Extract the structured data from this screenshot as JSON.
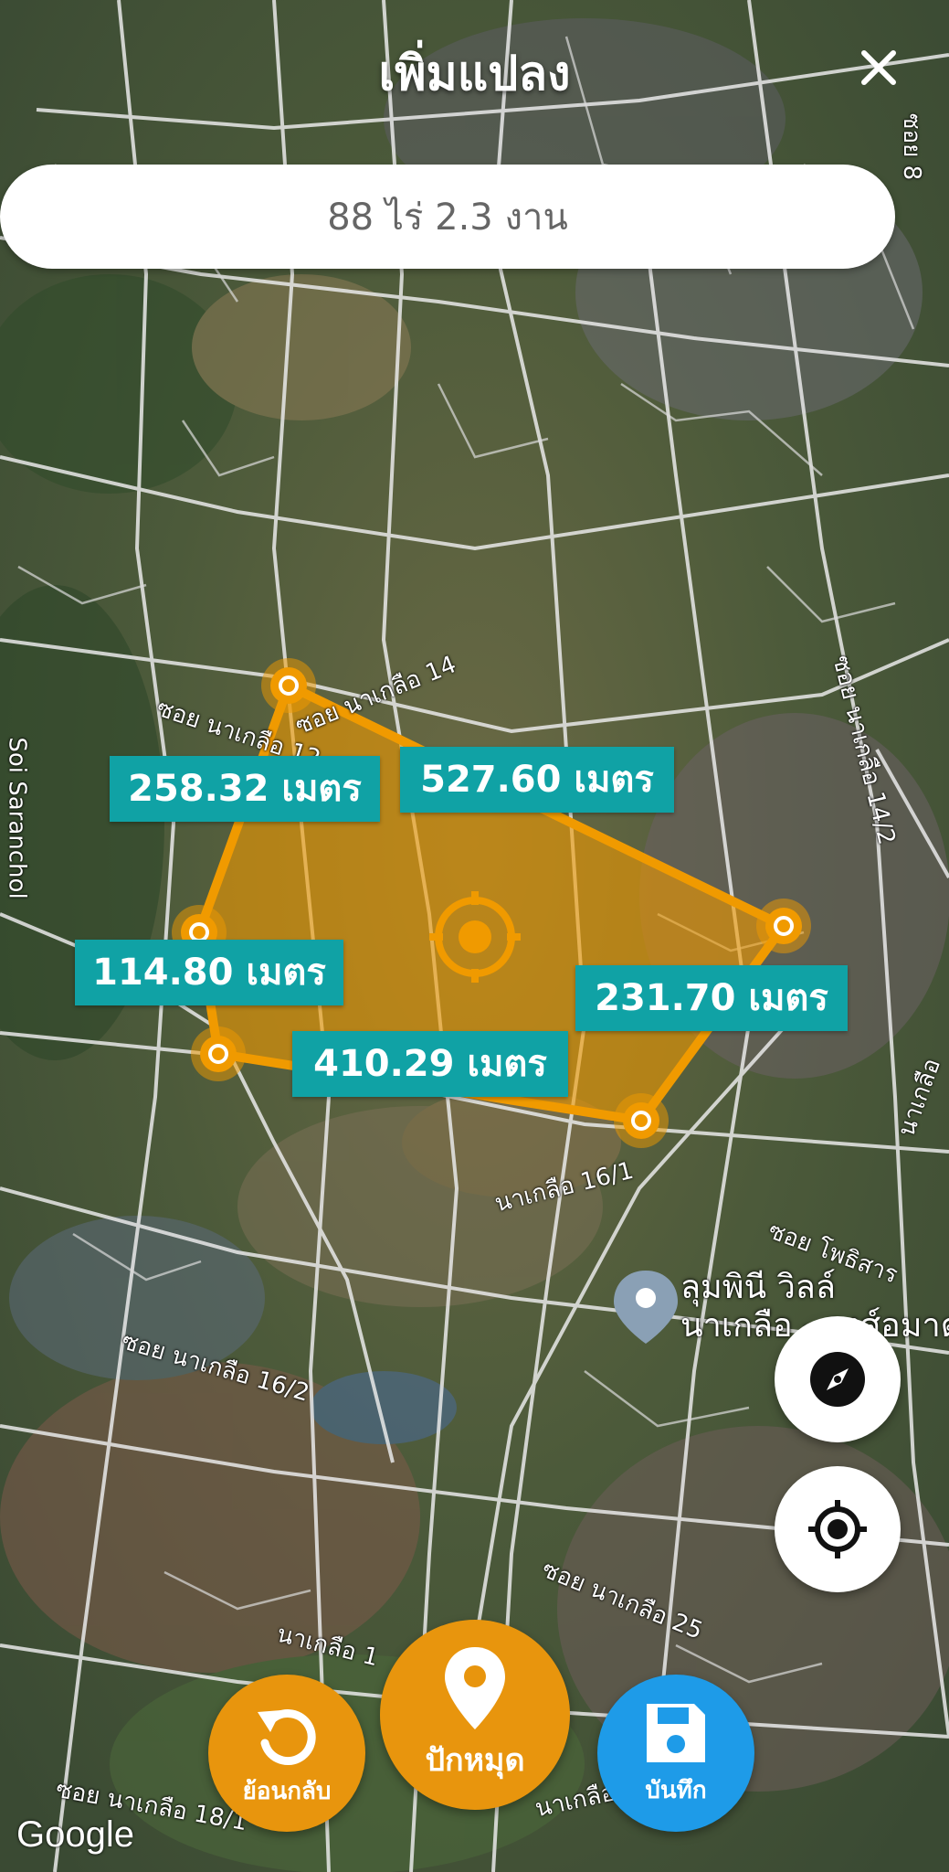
{
  "header": {
    "title": "เพิ่มแปลง"
  },
  "area": {
    "text": "88 ไร่ 2.3 งาน"
  },
  "distances": [
    "258.32 เมตร",
    "527.60 เมตร",
    "114.80 เมตร",
    "231.70 เมตร",
    "410.29 เมตร"
  ],
  "map": {
    "roads": [
      "ซอย นาเกลือ 14",
      "ซอย นาเกลือ 12",
      "ซอย นาเกลือ 14/2",
      "นาเกลือ 16/1",
      "ซอย โพธิสาร",
      "ซอย นาเกลือ 16/2",
      "ซอย นาเกลือ 25",
      "นาเกลือ 1",
      "ซอย นาเกลือ 18/1",
      "นาเกลือ 29",
      "Soi Saranchol",
      "ซอย 8",
      "นาเกลือ"
    ],
    "place": {
      "line1": "ลุมพินี วิลล์",
      "line2": "นาเกลือ - วงศ์อมาต"
    },
    "attribution": "Google"
  },
  "buttons": {
    "undo": "ย้อนกลับ",
    "pin": "ปักหมุด",
    "save": "บันทึก"
  },
  "colors": {
    "polygon": "#f09a00",
    "label_bg": "#10a2a5",
    "action": "#e8950d",
    "save": "#1e9be8"
  },
  "icons": {
    "close": "close-icon",
    "compass": "compass-icon",
    "locate": "crosshair-icon",
    "undo": "undo-icon",
    "pin": "map-pin-icon",
    "save": "floppy-disk-icon"
  }
}
